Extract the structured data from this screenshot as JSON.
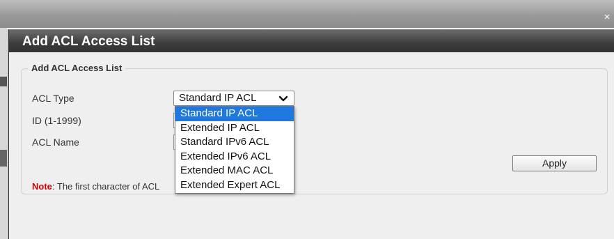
{
  "window": {
    "close_icon": "close-icon",
    "close_glyph": "×"
  },
  "dialog": {
    "title": "Add ACL Access List"
  },
  "form": {
    "legend": "Add ACL Access List",
    "acl_type_label": "ACL Type",
    "id_label": "ID (1-1999)",
    "acl_name_label": "ACL Name",
    "acl_type_value": "Standard IP ACL",
    "apply_label": "Apply",
    "note_label": "Note",
    "note_text": ":  The first character of ACL"
  },
  "dropdown": {
    "options": [
      "Standard IP ACL",
      "Extended IP ACL",
      "Standard IPv6 ACL",
      "Extended IPv6 ACL",
      "Extended MAC ACL",
      "Extended Expert ACL"
    ],
    "selected_index": 0,
    "highlight_color": "#1e78e0"
  },
  "colors": {
    "note_label": "#d40000",
    "header_background": "#3c3c3c"
  }
}
